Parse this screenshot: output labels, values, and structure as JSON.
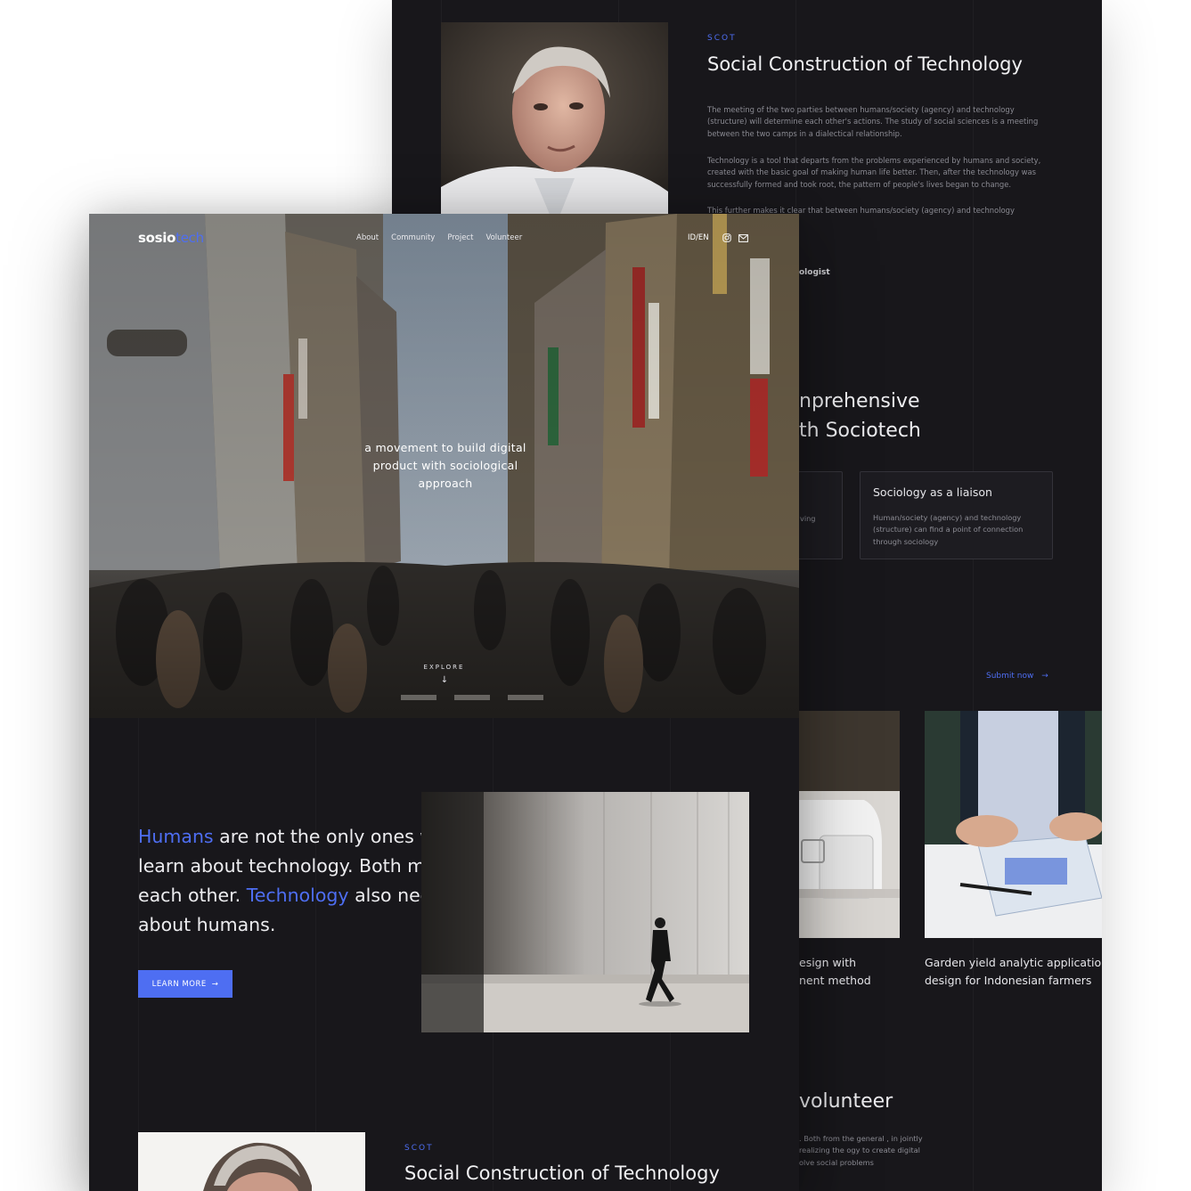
{
  "back_page": {
    "scot_label": "SCOT",
    "scot_title": "Social Construction of Technology",
    "paragraphs": [
      "The meeting of the two parties between humans/society (agency) and technology (structure) will determine each other's actions. The study of social sciences is a meeting between the two camps in a dialectical relationship.",
      "Technology is a tool that departs from the problems experienced by humans and society, created with the basic goal of making human life better. Then, after the technology was successfully formed and took root, the pattern of people's lives began to change.",
      "This further makes it clear that between humans/society (agency) and technology sustainable."
    ],
    "role_fragment": "ologist",
    "section_title_line1": "nprehensive",
    "section_title_line2": "th Sociotech",
    "card_left_fragment": "ving",
    "card": {
      "title": "Sociology as a liaison",
      "description": "Human/society (agency) and technology (structure) can find a point of connection through sociology"
    },
    "submit_label": "Submit now",
    "projects": [
      {
        "caption_line1": "esign with",
        "caption_line2": "nent method"
      },
      {
        "caption_line1": "Garden yield analytic application",
        "caption_line2": "design for Indonesian farmers"
      }
    ],
    "volunteer_title": "volunteer",
    "volunteer_desc": ". Both from the general , in jointly realizing the ogy to create digital olve social problems"
  },
  "front_page": {
    "logo_main": "sosio",
    "logo_accent": "tech",
    "nav": [
      "About",
      "Community",
      "Project",
      "Volunteer"
    ],
    "lang": "ID/EN",
    "hero_tagline": "a movement to build digital product with sociological approach",
    "explore_label": "EXPLORE",
    "explore_arrow": "↓",
    "quote_hl1": "Humans",
    "quote_part1": " are not the only ones who need to learn about technology. Both must need each other. ",
    "quote_hl2": "Technology",
    "quote_part2": " also needs to learn about humans.",
    "learn_more": "LEARN MORE",
    "arrow": "→",
    "scot_label": "SCOT",
    "scot_title": "Social Construction of Technology"
  },
  "colors": {
    "accent": "#4e6ef2",
    "background": "#18171b",
    "text": "#ececef"
  },
  "icons": [
    "instagram-icon",
    "mail-icon",
    "arrow-right-icon",
    "arrow-down-icon"
  ]
}
